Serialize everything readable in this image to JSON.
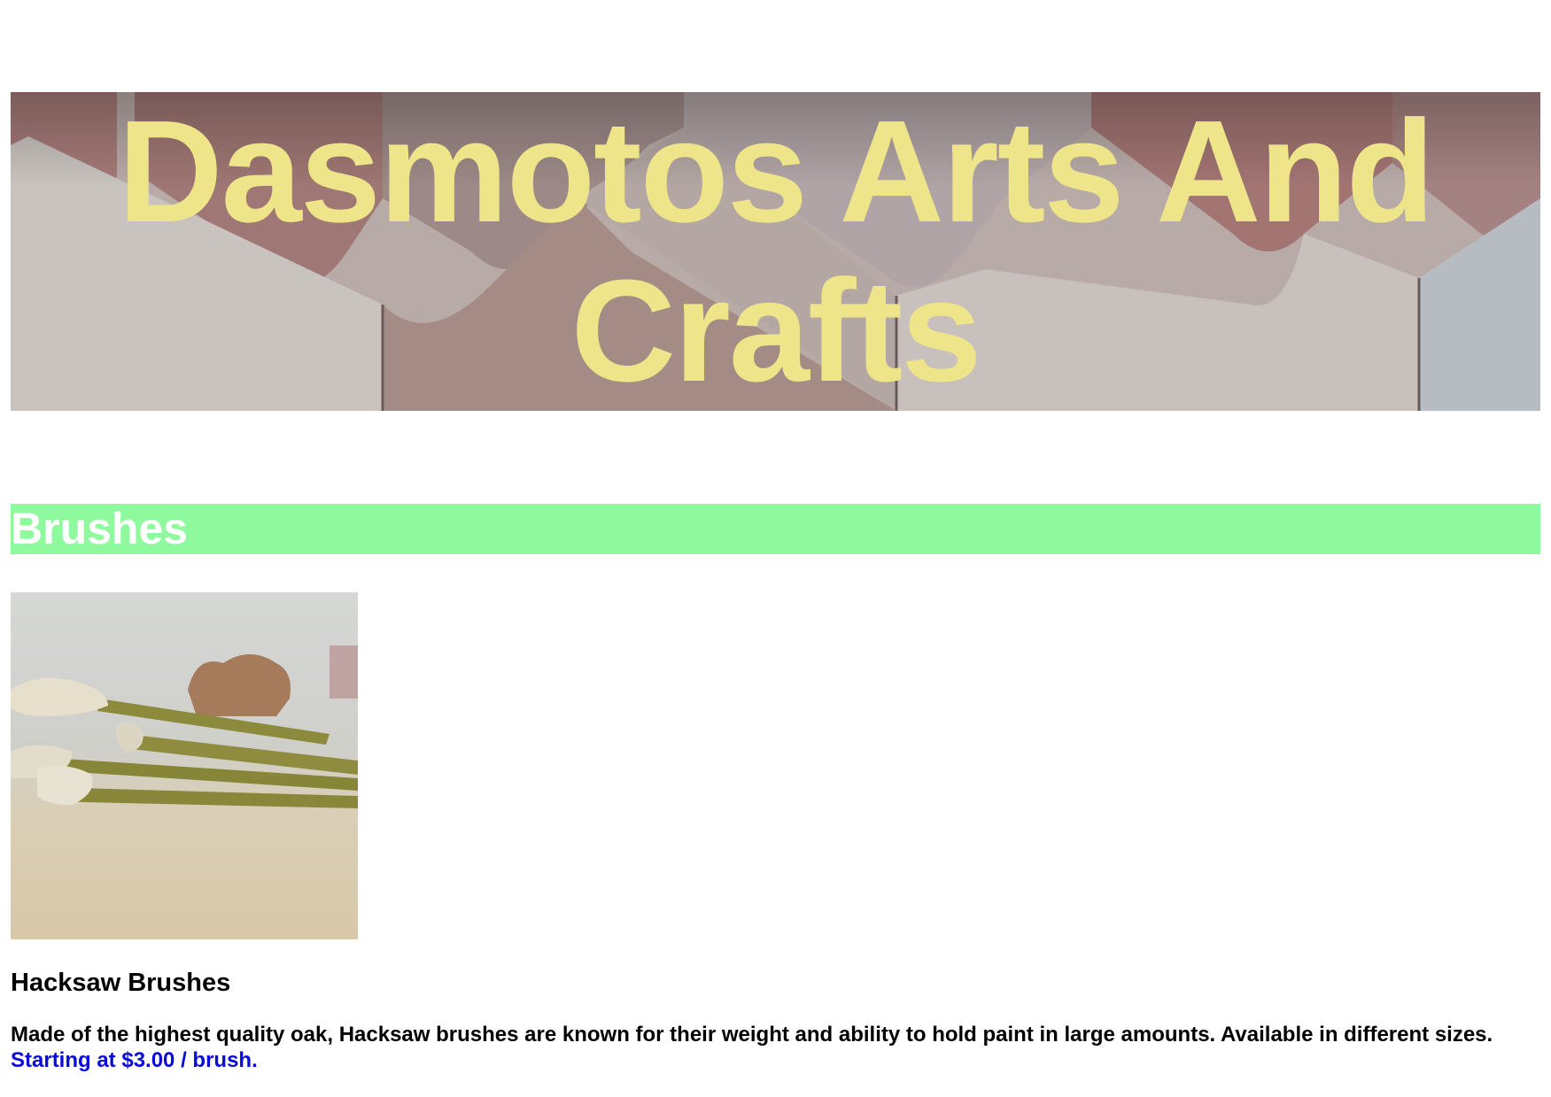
{
  "header": {
    "title": "Dasmotos Arts And Crafts",
    "title_color": "#eee58a",
    "background_image": "roof-tiles-photo"
  },
  "section": {
    "title": "Brushes",
    "background_color": "#8ffa9d"
  },
  "product": {
    "image": "brushes-photo",
    "name": "Hacksaw Brushes",
    "description": "Made of the highest quality oak, Hacksaw brushes are known for their weight and ability to hold paint in large amounts. Available in different sizes.",
    "price": "Starting at $3.00 / brush.",
    "price_color": "#0a0adc"
  }
}
